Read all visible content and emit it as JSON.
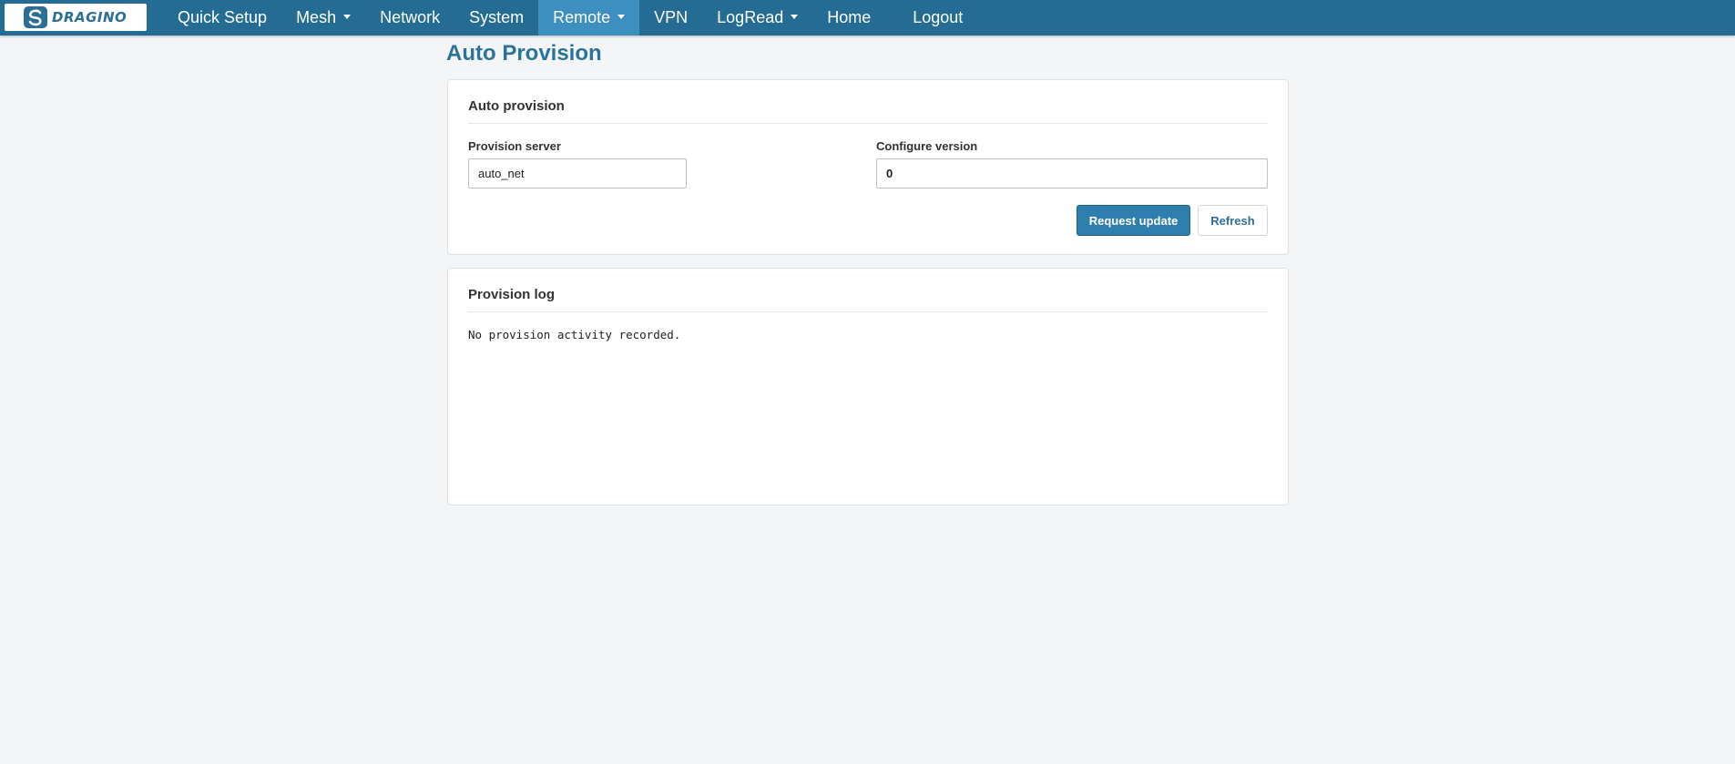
{
  "brand": {
    "logo_text": "DRAGINO",
    "logo_icon": "dragino-logo-icon"
  },
  "nav": {
    "items": [
      {
        "label": "Quick Setup",
        "has_dropdown": false
      },
      {
        "label": "Mesh",
        "has_dropdown": true
      },
      {
        "label": "Network",
        "has_dropdown": false
      },
      {
        "label": "System",
        "has_dropdown": false
      },
      {
        "label": "Remote",
        "has_dropdown": true,
        "active": true
      },
      {
        "label": "VPN",
        "has_dropdown": false
      },
      {
        "label": "LogRead",
        "has_dropdown": true
      },
      {
        "label": "Home",
        "has_dropdown": false
      },
      {
        "label": "Logout",
        "has_dropdown": false
      }
    ]
  },
  "page": {
    "title": "Auto Provision"
  },
  "auto_provision": {
    "title": "Auto provision",
    "provision_server": {
      "label": "Provision server",
      "value": "auto_net"
    },
    "configure_version": {
      "label": "Configure version",
      "value": "0"
    },
    "request_update_label": "Request update",
    "refresh_label": "Refresh"
  },
  "provision_log": {
    "title": "Provision log",
    "text": "No provision activity recorded."
  },
  "colors": {
    "navbar": "#246c93",
    "nav_active": "#3c8fbf",
    "accent": "#2c7399",
    "primary_button": "#2e7fad",
    "page_background": "#f3f5f7"
  }
}
